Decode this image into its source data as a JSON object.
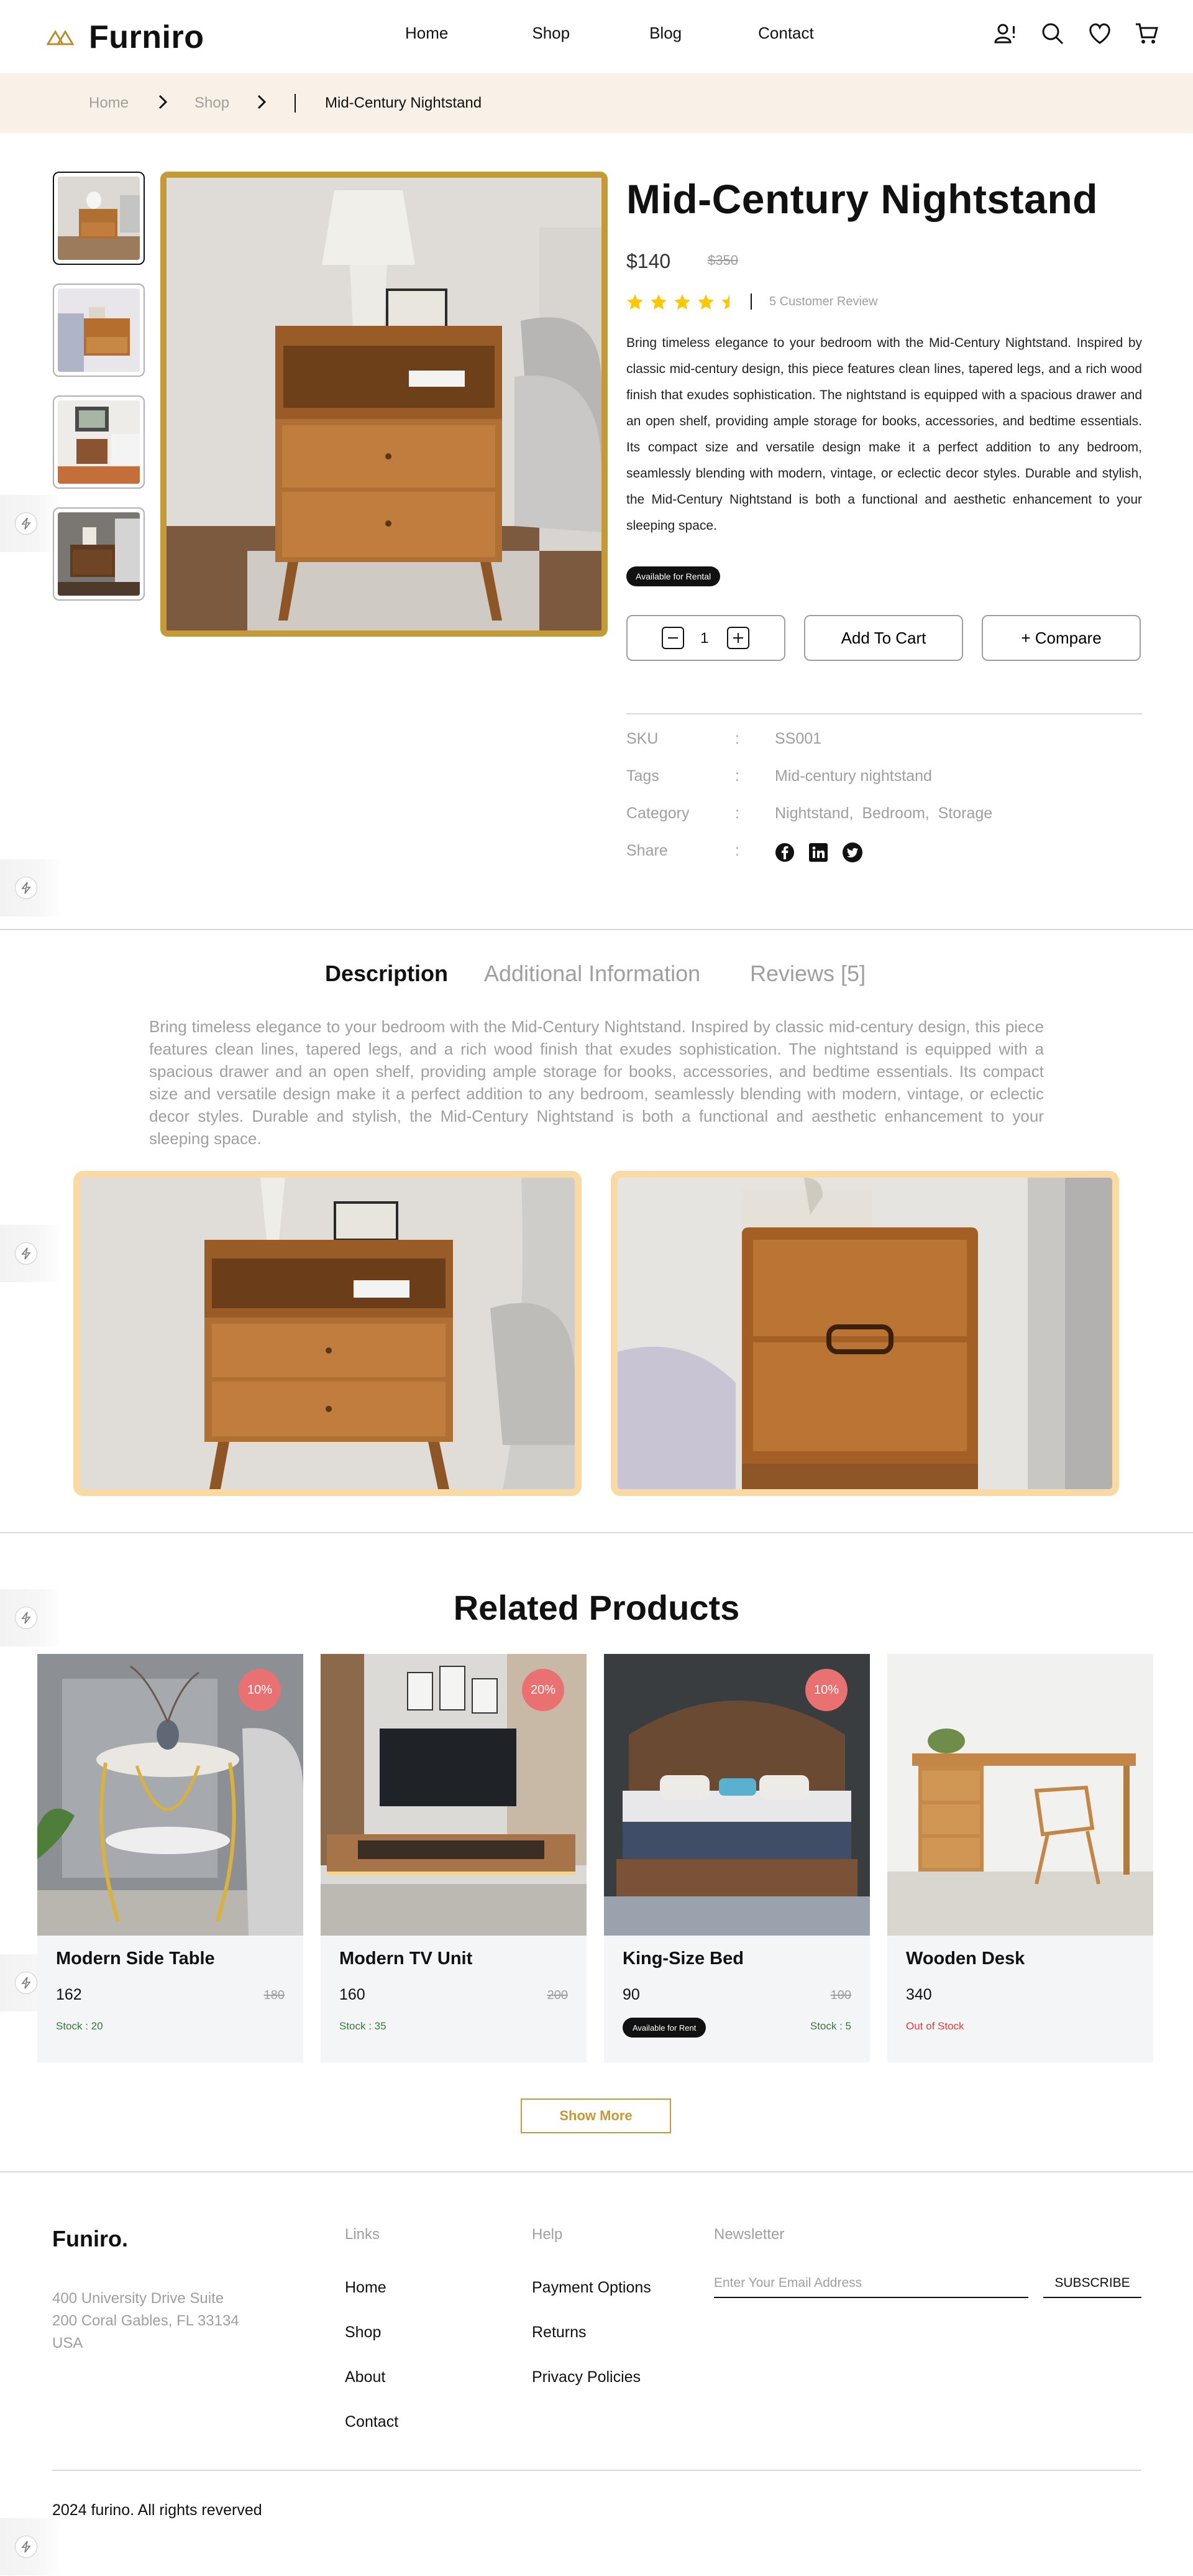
{
  "header": {
    "logo_text": "Furniro",
    "nav": [
      "Home",
      "Shop",
      "Blog",
      "Contact"
    ]
  },
  "breadcrumb": {
    "home": "Home",
    "shop": "Shop",
    "current": "Mid-Century Nightstand"
  },
  "product": {
    "title": "Mid-Century Nightstand",
    "price": "$140",
    "old_price": "$350",
    "rating": 4.5,
    "review_count": "5 Customer Review",
    "description": "Bring timeless elegance to your bedroom with the Mid-Century Nightstand. Inspired by classic mid-century design, this piece features clean lines, tapered legs, and a rich wood finish that exudes sophistication. The nightstand is equipped with a spacious drawer and an open shelf, providing ample storage for books, accessories, and bedtime essentials. Its compact size and versatile design make it a perfect addition to any bedroom, seamlessly blending with modern, vintage, or eclectic decor styles. Durable and stylish, the Mid-Century Nightstand is both a functional and aesthetic enhancement to your sleeping space.",
    "rental_badge": "Available for Rental",
    "quantity": "1",
    "add_to_cart": "Add To Cart",
    "compare": "+ Compare",
    "meta": {
      "sku_label": "SKU",
      "sku_value": "SS001",
      "tags_label": "Tags",
      "tags_value": "Mid-century nightstand",
      "category_label": "Category",
      "category_value": "Nightstand,  Bedroom,  Storage",
      "share_label": "Share",
      "colon": ":"
    }
  },
  "tabs": [
    "Description",
    "Additional Information",
    "Reviews [5]"
  ],
  "long_description": "Bring timeless elegance to your bedroom with the Mid-Century Nightstand. Inspired by classic mid-century design, this piece features clean lines, tapered legs, and a rich wood finish that exudes sophistication. The nightstand is equipped with a spacious drawer and an open shelf, providing ample storage for books, accessories, and bedtime essentials. Its compact size and versatile design make it a perfect addition to any bedroom, seamlessly blending with modern, vintage, or eclectic decor styles. Durable and stylish, the Mid-Century Nightstand is both a functional and aesthetic enhancement to your sleeping space.",
  "related": {
    "title": "Related Products",
    "products": [
      {
        "name": "Modern Side Table",
        "price": "162",
        "old_price": "180",
        "discount": "10%",
        "stock": "Stock : 20"
      },
      {
        "name": "Modern TV Unit",
        "price": "160",
        "old_price": "200",
        "discount": "20%",
        "stock": "Stock : 35"
      },
      {
        "name": "King-Size Bed",
        "price": "90",
        "old_price": "100",
        "discount": "10%",
        "stock": "Stock : 5",
        "rent": "Available for Rent"
      },
      {
        "name": "Wooden Desk",
        "price": "340",
        "stock": "Out of Stock"
      }
    ],
    "show_more": "Show More"
  },
  "footer": {
    "brand": "Funiro.",
    "address": [
      "400 University Drive Suite",
      "200 Coral Gables, FL 33134",
      "USA"
    ],
    "links_heading": "Links",
    "links": [
      "Home",
      "Shop",
      "About",
      "Contact"
    ],
    "help_heading": "Help",
    "help": [
      "Payment Options",
      "Returns",
      "Privacy Policies"
    ],
    "newsletter_heading": "Newsletter",
    "newsletter_placeholder": "Enter Your Email Address",
    "subscribe": "SUBSCRIBE",
    "copyright": "2024 furino. All rights reverved"
  },
  "colors": {
    "accent": "#b88e2f",
    "gold_border": "#c39a36",
    "breadcrumb_bg": "#f9f1e7",
    "discount": "#e97171"
  }
}
